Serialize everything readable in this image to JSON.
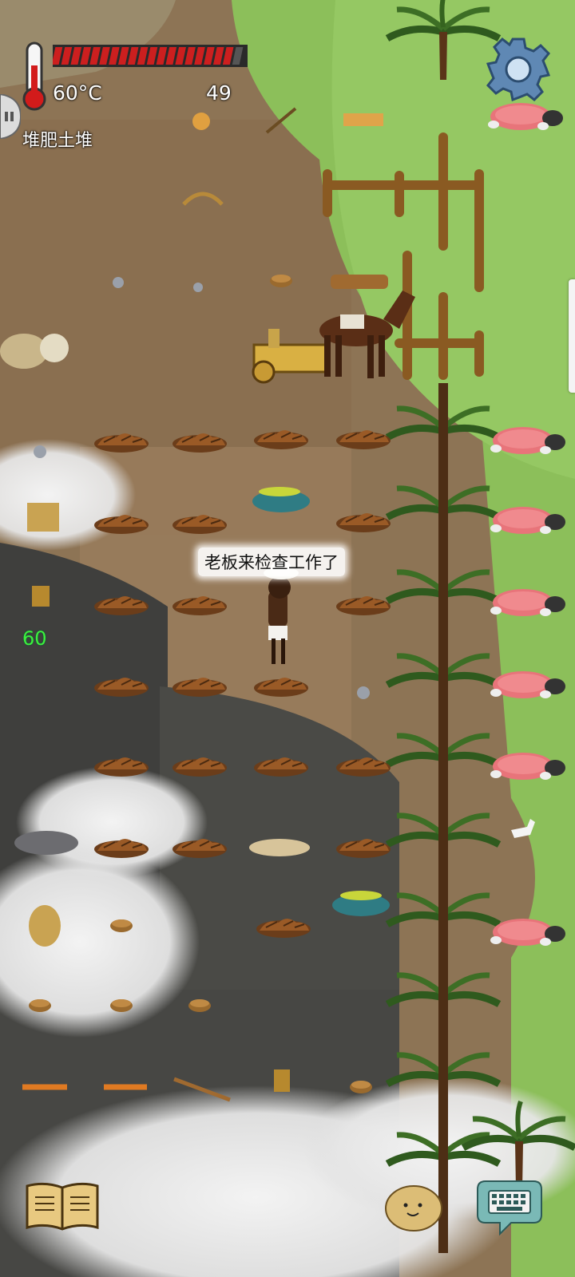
{
  "hud": {
    "temperature": "60°C",
    "food_counter": "49",
    "hunger_level": 0.93,
    "held_object_label": "堆肥土堆",
    "yum_counter": "60"
  },
  "speech": {
    "text": "老板来检查工作了"
  },
  "icons": {
    "thermometer": "thermometer-icon",
    "settings": "gear-icon",
    "recipe_book": "book-icon",
    "emote": "potato-face-icon",
    "chat": "keyboard-icon"
  },
  "colors": {
    "hunger_fill": "#cc1f1f",
    "hunger_back": "#2a2a2a",
    "yum_text": "#3df03d",
    "grass": "#8cbf5a",
    "soil": "#8d7455",
    "fog": "#ececec"
  }
}
